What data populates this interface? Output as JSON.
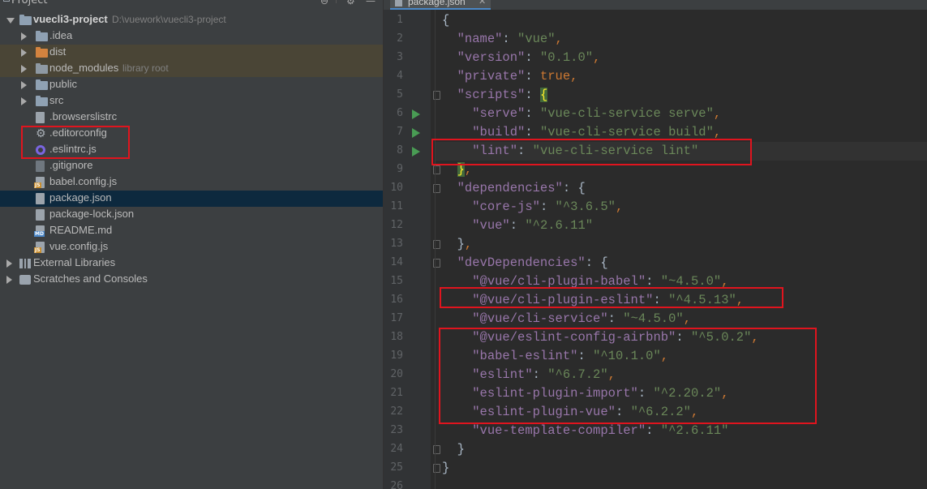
{
  "project_panel": {
    "title": "Project",
    "tree": [
      {
        "id": "root",
        "label": "vuecli3-project",
        "hint": "D:\\vuework\\vuecli3-project",
        "indent": 0,
        "arrow": "down",
        "icon": "folder",
        "bold": true
      },
      {
        "id": "idea",
        "label": ".idea",
        "indent": 1,
        "arrow": "right",
        "icon": "folder"
      },
      {
        "id": "dist",
        "label": "dist",
        "indent": 1,
        "arrow": "right",
        "icon": "folder-excluded",
        "excluded": true
      },
      {
        "id": "node_modules",
        "label": "node_modules",
        "hint": "library root",
        "indent": 1,
        "arrow": "right",
        "icon": "folder-library",
        "excluded": true
      },
      {
        "id": "public",
        "label": "public",
        "indent": 1,
        "arrow": "right",
        "icon": "folder"
      },
      {
        "id": "src",
        "label": "src",
        "indent": 1,
        "arrow": "right",
        "icon": "folder"
      },
      {
        "id": "browserslistrc",
        "label": ".browserslistrc",
        "indent": 1,
        "icon": "file-text"
      },
      {
        "id": "editorconfig",
        "label": ".editorconfig",
        "indent": 1,
        "icon": "gear-icon"
      },
      {
        "id": "eslintrc",
        "label": ".eslintrc.js",
        "indent": 1,
        "icon": "eslint-ring-icon"
      },
      {
        "id": "gitignore",
        "label": ".gitignore",
        "indent": 1,
        "icon": "file-git"
      },
      {
        "id": "babel_config",
        "label": "babel.config.js",
        "indent": 1,
        "icon": "file-js"
      },
      {
        "id": "package_json",
        "label": "package.json",
        "indent": 1,
        "icon": "file-json",
        "selected": true
      },
      {
        "id": "package_lock",
        "label": "package-lock.json",
        "indent": 1,
        "icon": "file-json"
      },
      {
        "id": "readme",
        "label": "README.md",
        "indent": 1,
        "icon": "file-md"
      },
      {
        "id": "vue_config",
        "label": "vue.config.js",
        "indent": 1,
        "icon": "file-js"
      },
      {
        "id": "external_libs",
        "label": "External Libraries",
        "indent": 0,
        "arrow": "right",
        "icon": "libraries-icon"
      },
      {
        "id": "scratches",
        "label": "Scratches and Consoles",
        "indent": 0,
        "arrow": "right",
        "icon": "scratches-icon"
      }
    ]
  },
  "editor": {
    "active_tab": "package.json",
    "lines": [
      {
        "n": "1",
        "tokens": [
          {
            "t": "{",
            "c": "c"
          }
        ],
        "indent": 0
      },
      {
        "n": "2",
        "tokens": [
          {
            "t": "\"name\"",
            "c": "k"
          },
          {
            "t": ": ",
            "c": "c"
          },
          {
            "t": "\"vue\"",
            "c": "s"
          },
          {
            "t": ",",
            "c": "p"
          }
        ],
        "indent": 1
      },
      {
        "n": "3",
        "tokens": [
          {
            "t": "\"version\"",
            "c": "k"
          },
          {
            "t": ": ",
            "c": "c"
          },
          {
            "t": "\"0.1.0\"",
            "c": "s"
          },
          {
            "t": ",",
            "c": "p"
          }
        ],
        "indent": 1
      },
      {
        "n": "4",
        "tokens": [
          {
            "t": "\"private\"",
            "c": "k"
          },
          {
            "t": ": ",
            "c": "c"
          },
          {
            "t": "true",
            "c": "b"
          },
          {
            "t": ",",
            "c": "p"
          }
        ],
        "indent": 1
      },
      {
        "n": "5",
        "tokens": [
          {
            "t": "\"scripts\"",
            "c": "k"
          },
          {
            "t": ": ",
            "c": "c"
          },
          {
            "t": "{",
            "c": "brace-hl"
          }
        ],
        "indent": 1,
        "fold": true
      },
      {
        "n": "6",
        "tokens": [
          {
            "t": "\"serve\"",
            "c": "k"
          },
          {
            "t": ": ",
            "c": "c"
          },
          {
            "t": "\"vue-cli-service serve\"",
            "c": "s"
          },
          {
            "t": ",",
            "c": "p"
          }
        ],
        "indent": 2,
        "run": true
      },
      {
        "n": "7",
        "tokens": [
          {
            "t": "\"build\"",
            "c": "k"
          },
          {
            "t": ": ",
            "c": "c"
          },
          {
            "t": "\"vue-cli-service build\"",
            "c": "s"
          },
          {
            "t": ",",
            "c": "p"
          }
        ],
        "indent": 2,
        "run": true
      },
      {
        "n": "8",
        "tokens": [
          {
            "t": "\"lint\"",
            "c": "k"
          },
          {
            "t": ": ",
            "c": "c"
          },
          {
            "t": "\"vue-cli-service lint\"",
            "c": "s"
          }
        ],
        "indent": 2,
        "run": true,
        "current": true
      },
      {
        "n": "9",
        "tokens": [
          {
            "t": "}",
            "c": "brace-hl"
          },
          {
            "t": ",",
            "c": "p"
          }
        ],
        "indent": 1,
        "fold": true
      },
      {
        "n": "10",
        "tokens": [
          {
            "t": "\"dependencies\"",
            "c": "k"
          },
          {
            "t": ": ",
            "c": "c"
          },
          {
            "t": "{",
            "c": "c"
          }
        ],
        "indent": 1,
        "fold": true
      },
      {
        "n": "11",
        "tokens": [
          {
            "t": "\"core-js\"",
            "c": "k"
          },
          {
            "t": ": ",
            "c": "c"
          },
          {
            "t": "\"^3.6.5\"",
            "c": "s"
          },
          {
            "t": ",",
            "c": "p"
          }
        ],
        "indent": 2
      },
      {
        "n": "12",
        "tokens": [
          {
            "t": "\"vue\"",
            "c": "k"
          },
          {
            "t": ": ",
            "c": "c"
          },
          {
            "t": "\"^2.6.11\"",
            "c": "s"
          }
        ],
        "indent": 2
      },
      {
        "n": "13",
        "tokens": [
          {
            "t": "}",
            "c": "c"
          },
          {
            "t": ",",
            "c": "p"
          }
        ],
        "indent": 1,
        "fold": true
      },
      {
        "n": "14",
        "tokens": [
          {
            "t": "\"devDependencies\"",
            "c": "k"
          },
          {
            "t": ": ",
            "c": "c"
          },
          {
            "t": "{",
            "c": "c"
          }
        ],
        "indent": 1,
        "fold": true
      },
      {
        "n": "15",
        "tokens": [
          {
            "t": "\"@vue/cli-plugin-babel\"",
            "c": "k"
          },
          {
            "t": ": ",
            "c": "c"
          },
          {
            "t": "\"~4.5.0\"",
            "c": "s"
          },
          {
            "t": ",",
            "c": "p"
          }
        ],
        "indent": 2
      },
      {
        "n": "16",
        "tokens": [
          {
            "t": "\"@vue/cli-plugin-eslint\"",
            "c": "k"
          },
          {
            "t": ": ",
            "c": "c"
          },
          {
            "t": "\"^4.5.13\"",
            "c": "s"
          },
          {
            "t": ",",
            "c": "p"
          }
        ],
        "indent": 2
      },
      {
        "n": "17",
        "tokens": [
          {
            "t": "\"@vue/cli-service\"",
            "c": "k"
          },
          {
            "t": ": ",
            "c": "c"
          },
          {
            "t": "\"~4.5.0\"",
            "c": "s"
          },
          {
            "t": ",",
            "c": "p"
          }
        ],
        "indent": 2
      },
      {
        "n": "18",
        "tokens": [
          {
            "t": "\"@vue/eslint-config-airbnb\"",
            "c": "k"
          },
          {
            "t": ": ",
            "c": "c"
          },
          {
            "t": "\"^5.0.2\"",
            "c": "s"
          },
          {
            "t": ",",
            "c": "p"
          }
        ],
        "indent": 2
      },
      {
        "n": "19",
        "tokens": [
          {
            "t": "\"babel-eslint\"",
            "c": "k"
          },
          {
            "t": ": ",
            "c": "c"
          },
          {
            "t": "\"^10.1.0\"",
            "c": "s"
          },
          {
            "t": ",",
            "c": "p"
          }
        ],
        "indent": 2
      },
      {
        "n": "20",
        "tokens": [
          {
            "t": "\"eslint\"",
            "c": "k"
          },
          {
            "t": ": ",
            "c": "c"
          },
          {
            "t": "\"^6.7.2\"",
            "c": "s"
          },
          {
            "t": ",",
            "c": "p"
          }
        ],
        "indent": 2
      },
      {
        "n": "21",
        "tokens": [
          {
            "t": "\"eslint-plugin-import\"",
            "c": "k"
          },
          {
            "t": ": ",
            "c": "c"
          },
          {
            "t": "\"^2.20.2\"",
            "c": "s"
          },
          {
            "t": ",",
            "c": "p"
          }
        ],
        "indent": 2
      },
      {
        "n": "22",
        "tokens": [
          {
            "t": "\"eslint-plugin-vue\"",
            "c": "k"
          },
          {
            "t": ": ",
            "c": "c"
          },
          {
            "t": "\"^6.2.2\"",
            "c": "s"
          },
          {
            "t": ",",
            "c": "p"
          }
        ],
        "indent": 2
      },
      {
        "n": "23",
        "tokens": [
          {
            "t": "\"vue-template-compiler\"",
            "c": "k"
          },
          {
            "t": ": ",
            "c": "c"
          },
          {
            "t": "\"^2.6.11\"",
            "c": "s"
          }
        ],
        "indent": 2
      },
      {
        "n": "24",
        "tokens": [
          {
            "t": "}",
            "c": "c"
          }
        ],
        "indent": 1,
        "fold": true
      },
      {
        "n": "25",
        "tokens": [
          {
            "t": "}",
            "c": "c"
          }
        ],
        "indent": 0,
        "fold": true
      },
      {
        "n": "26",
        "tokens": [],
        "indent": 0
      }
    ]
  },
  "colors": {
    "json_key": "#9876aa",
    "json_string": "#6a8759",
    "keyword": "#cc7832",
    "highlight_box": "#e0141e",
    "run_icon": "#499c54"
  }
}
